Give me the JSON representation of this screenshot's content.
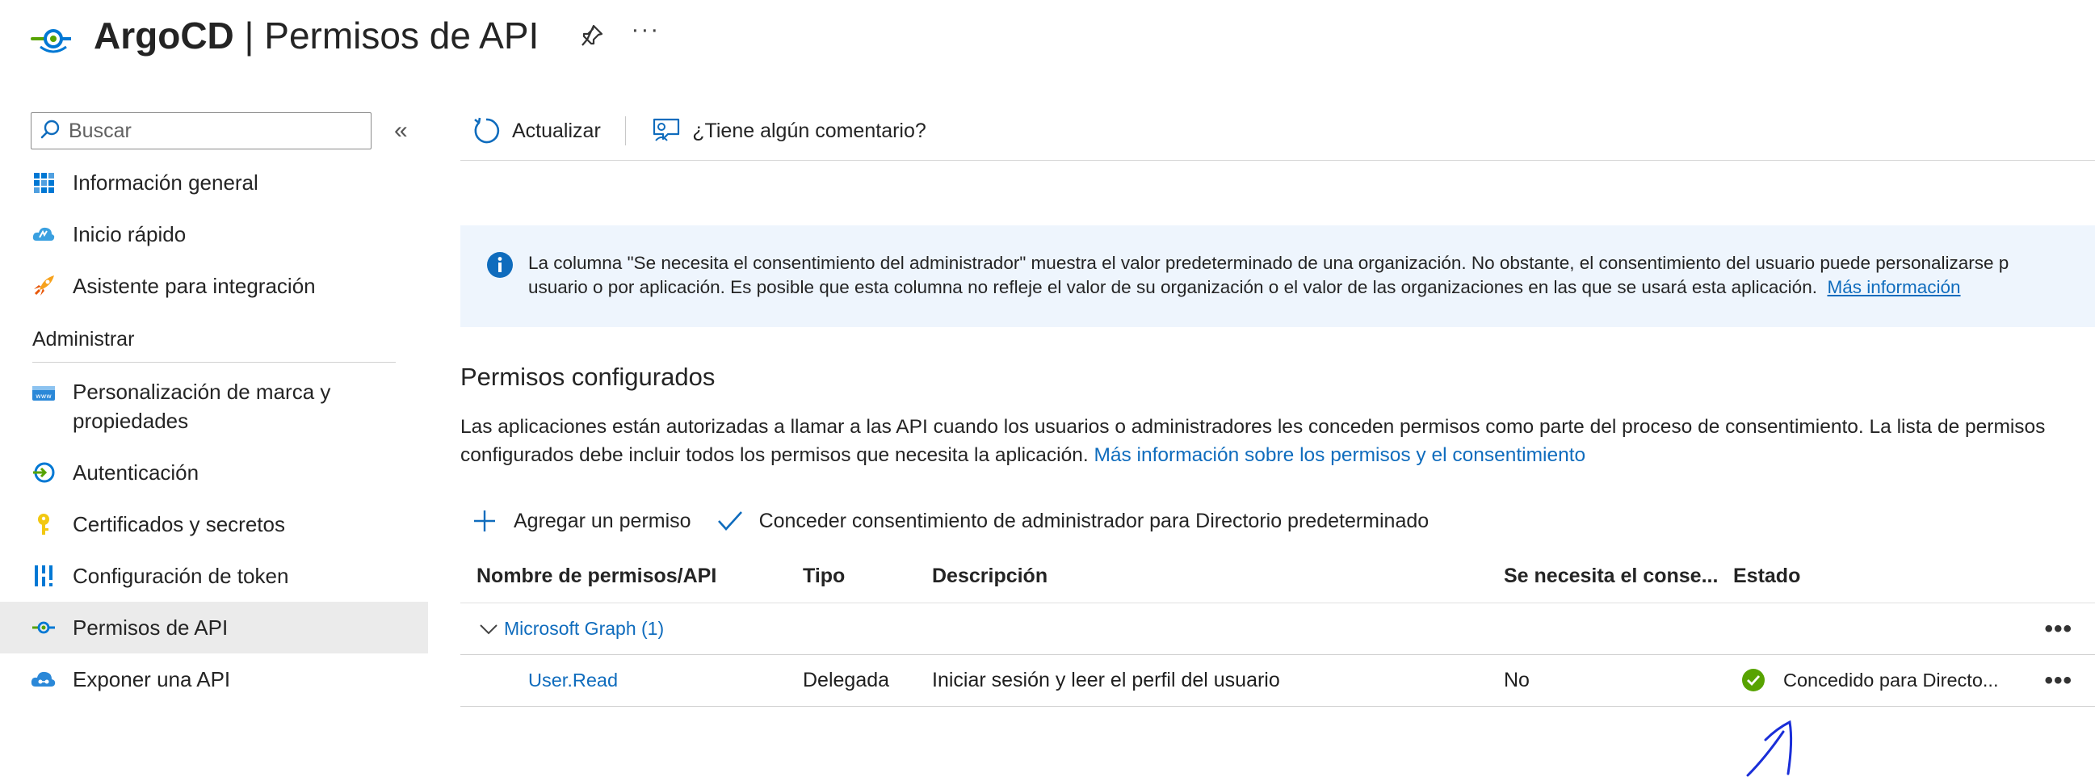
{
  "header": {
    "app_name": "ArgoCD",
    "separator": " | ",
    "page_name": "Permisos de API",
    "more_label": "···"
  },
  "sidebar": {
    "search_placeholder": "Buscar",
    "collapse_label": "«",
    "items": [
      {
        "label": "Información general",
        "icon": "grid-icon"
      },
      {
        "label": "Inicio rápido",
        "icon": "cloud-icon"
      },
      {
        "label": "Asistente para integración",
        "icon": "rocket-icon"
      }
    ],
    "section_label": "Administrar",
    "manage_items": [
      {
        "label": "Personalización de marca y propiedades",
        "icon": "branding-icon"
      },
      {
        "label": "Autenticación",
        "icon": "auth-icon"
      },
      {
        "label": "Certificados y secretos",
        "icon": "key-icon"
      },
      {
        "label": "Configuración de token",
        "icon": "token-icon"
      },
      {
        "label": "Permisos de API",
        "icon": "api-permissions-icon",
        "active": true
      },
      {
        "label": "Exponer una API",
        "icon": "cloud-api-icon"
      }
    ]
  },
  "toolbar": {
    "refresh_label": "Actualizar",
    "feedback_label": "¿Tiene algún comentario?"
  },
  "info_bar": {
    "line1": "La columna \"Se necesita el consentimiento del administrador\" muestra el valor predeterminado de una organización. No obstante, el consentimiento del usuario puede personalizarse p",
    "line2": "usuario o por aplicación. Es posible que esta columna no refleje el valor de su organización o el valor de las organizaciones en las que se usará esta aplicación.",
    "link": "Más información"
  },
  "permissions": {
    "title": "Permisos configurados",
    "description": "Las aplicaciones están autorizadas a llamar a las API cuando los usuarios o administradores les conceden permisos como parte del proceso de consentimiento. La lista de permisos configurados debe incluir todos los permisos que necesita la aplicación.",
    "description_link": "Más información sobre los permisos y el consentimiento",
    "add_label": "Agregar un permiso",
    "grant_label": "Conceder consentimiento de administrador para Directorio predeterminado"
  },
  "table": {
    "columns": [
      "Nombre de permisos/API",
      "Tipo",
      "Descripción",
      "Se necesita el conse...",
      "Estado"
    ],
    "group": {
      "label": "Microsoft Graph (1)"
    },
    "rows": [
      {
        "name": "User.Read",
        "type": "Delegada",
        "description": "Iniciar sesión y leer el perfil del usuario",
        "admin_consent": "No",
        "status": "Concedido para Directo..."
      }
    ]
  },
  "colors": {
    "accent": "#0f6cbd",
    "success": "#6bb700",
    "info_bg": "#eef5fd",
    "active_bg": "#ebebeb"
  }
}
